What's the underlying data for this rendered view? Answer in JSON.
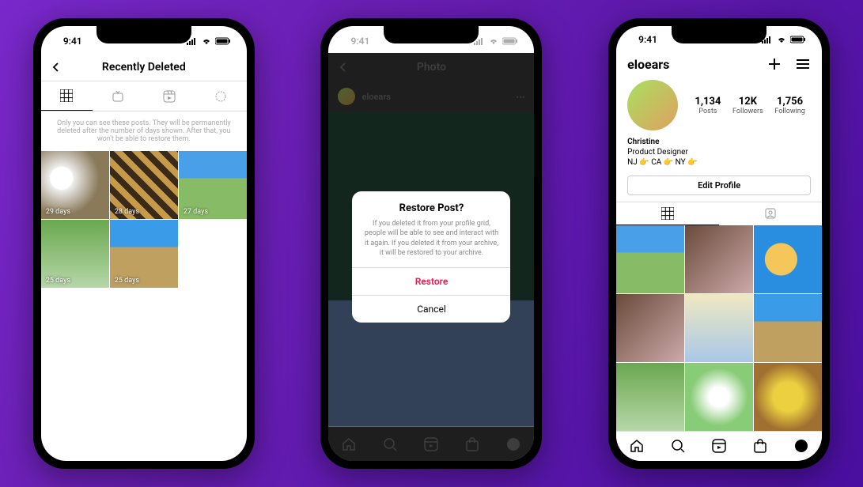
{
  "status": {
    "time": "9:41"
  },
  "phone1": {
    "title": "Recently Deleted",
    "notice": "Only you can see these posts. They will be permanently deleted after the number of days shown. After that, you won't be able to restore them.",
    "thumbs": [
      {
        "label": "29 days"
      },
      {
        "label": "28 days"
      },
      {
        "label": "27 days"
      },
      {
        "label": "25 days"
      },
      {
        "label": "25 days"
      }
    ]
  },
  "phone2": {
    "title": "Photo",
    "poster": "eloears",
    "dialog": {
      "title": "Restore Post?",
      "body": "If you deleted it from your profile grid, people will be able to see and interact with it again. If you deleted it from your archive, it will be restored to your archive.",
      "primary": "Restore",
      "secondary": "Cancel"
    }
  },
  "phone3": {
    "username": "eloears",
    "stats": {
      "posts_num": "1,134",
      "posts_lbl": "Posts",
      "followers_num": "12K",
      "followers_lbl": "Followers",
      "following_num": "1,756",
      "following_lbl": "Following"
    },
    "bio": {
      "name": "Christine",
      "line1": "Product Designer",
      "line2": "NJ 👉 CA 👉 NY 👉"
    },
    "edit": "Edit Profile"
  }
}
